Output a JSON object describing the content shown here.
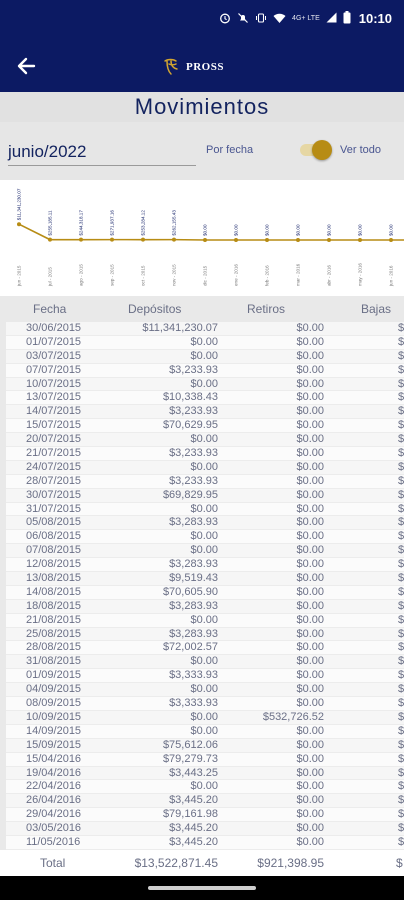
{
  "status_bar": {
    "time": "10:10",
    "lte": "4G+ LTE",
    "icons": [
      "alarm-icon",
      "mute-icon",
      "vibrate-icon",
      "wifi-icon",
      "signal-icon",
      "signal-icon",
      "battery-icon"
    ]
  },
  "appbar": {
    "back_icon": "arrow-left-icon",
    "logo_text": "PROSS"
  },
  "page": {
    "title": "Movimientos"
  },
  "filters": {
    "date_value": "junio/2022",
    "por_fecha_label": "Por fecha",
    "ver_todo_label": "Ver todo",
    "ver_todo_enabled": true
  },
  "colors": {
    "primary": "#0c1a63",
    "accent": "#b78c14",
    "text_muted": "#6a6f86"
  },
  "chart_data": {
    "type": "line",
    "x": [
      "jun - 2015",
      "jul - 2015",
      "ago - 2015",
      "sep - 2015",
      "oct - 2015",
      "nov - 2015",
      "dic - 2015",
      "ene - 2016",
      "feb - 2016",
      "mar - 2016",
      "abr - 2016",
      "may - 2016",
      "jun - 2016"
    ],
    "series": [
      {
        "values": [
          11341230.07,
          255185.11,
          244318.17,
          271937.16,
          253284.12,
          262155.43,
          0,
          0,
          0,
          0,
          0,
          0,
          0
        ]
      }
    ],
    "point_labels": [
      "$11,341,230.07",
      "$255,185.11",
      "$244,318.17",
      "$271,937.16",
      "$253,284.12",
      "$262,155.43",
      "$0.00",
      "$0.00",
      "$0.00",
      "$0.00",
      "$0.00",
      "$0.00",
      "$0.00"
    ],
    "ylim": [
      0,
      11500000
    ]
  },
  "table": {
    "columns": [
      "Fecha",
      "Depósitos",
      "Retiros",
      "Bajas"
    ],
    "rows": [
      [
        "30/06/2015",
        "$11,341,230.07",
        "$0.00"
      ],
      [
        "01/07/2015",
        "$0.00",
        "$0.00"
      ],
      [
        "03/07/2015",
        "$0.00",
        "$0.00"
      ],
      [
        "07/07/2015",
        "$3,233.93",
        "$0.00"
      ],
      [
        "10/07/2015",
        "$0.00",
        "$0.00"
      ],
      [
        "13/07/2015",
        "$10,338.43",
        "$0.00"
      ],
      [
        "14/07/2015",
        "$3,233.93",
        "$0.00"
      ],
      [
        "15/07/2015",
        "$70,629.95",
        "$0.00"
      ],
      [
        "20/07/2015",
        "$0.00",
        "$0.00"
      ],
      [
        "21/07/2015",
        "$3,233.93",
        "$0.00"
      ],
      [
        "24/07/2015",
        "$0.00",
        "$0.00"
      ],
      [
        "28/07/2015",
        "$3,233.93",
        "$0.00"
      ],
      [
        "30/07/2015",
        "$69,829.95",
        "$0.00"
      ],
      [
        "31/07/2015",
        "$0.00",
        "$0.00"
      ],
      [
        "05/08/2015",
        "$3,283.93",
        "$0.00"
      ],
      [
        "06/08/2015",
        "$0.00",
        "$0.00"
      ],
      [
        "07/08/2015",
        "$0.00",
        "$0.00"
      ],
      [
        "12/08/2015",
        "$3,283.93",
        "$0.00"
      ],
      [
        "13/08/2015",
        "$9,519.43",
        "$0.00"
      ],
      [
        "14/08/2015",
        "$70,605.90",
        "$0.00"
      ],
      [
        "18/08/2015",
        "$3,283.93",
        "$0.00"
      ],
      [
        "21/08/2015",
        "$0.00",
        "$0.00"
      ],
      [
        "25/08/2015",
        "$3,283.93",
        "$0.00"
      ],
      [
        "28/08/2015",
        "$72,002.57",
        "$0.00"
      ],
      [
        "31/08/2015",
        "$0.00",
        "$0.00"
      ],
      [
        "01/09/2015",
        "$3,333.93",
        "$0.00"
      ],
      [
        "04/09/2015",
        "$0.00",
        "$0.00"
      ],
      [
        "08/09/2015",
        "$3,333.93",
        "$0.00"
      ],
      [
        "10/09/2015",
        "$0.00",
        "$532,726.52"
      ],
      [
        "14/09/2015",
        "$0.00",
        "$0.00"
      ],
      [
        "15/09/2015",
        "$75,612.06",
        "$0.00"
      ],
      [
        "15/04/2016",
        "$79,279.73",
        "$0.00"
      ],
      [
        "19/04/2016",
        "$3,443.25",
        "$0.00"
      ],
      [
        "22/04/2016",
        "$0.00",
        "$0.00"
      ],
      [
        "26/04/2016",
        "$3,445.20",
        "$0.00"
      ],
      [
        "29/04/2016",
        "$79,161.98",
        "$0.00"
      ],
      [
        "03/05/2016",
        "$3,445.20",
        "$0.00"
      ],
      [
        "11/05/2016",
        "$3,445.20",
        "$0.00"
      ]
    ],
    "totals": {
      "label": "Total",
      "depositos": "$13,522,871.45",
      "retiros": "$921,398.95"
    }
  }
}
